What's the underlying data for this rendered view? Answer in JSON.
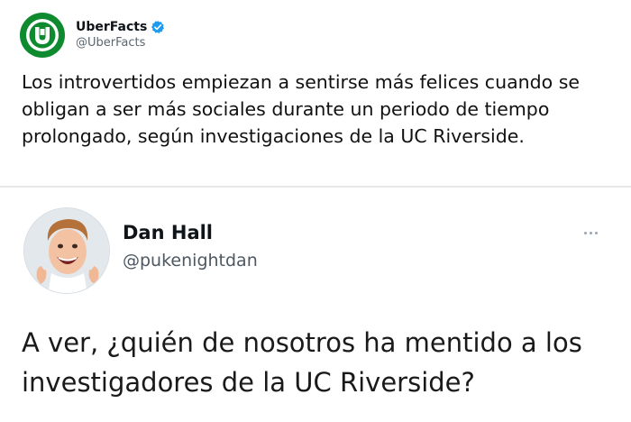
{
  "quoted_tweet": {
    "avatar_icon": "uberfacts-logo-icon",
    "brand_color": "#0f8a2f",
    "author_name": "UberFacts",
    "verified_icon": "verified-badge-icon",
    "verified_color": "#1d9bf0",
    "handle": "@UberFacts",
    "text": "Los introvertidos empiezan a sentirse más felices cuando se obligan a ser más sociales durante un periodo de tiempo prolongado, según investigaciones de la UC Riverside."
  },
  "reply_tweet": {
    "avatar_icon": "profile-photo",
    "author_name": "Dan Hall",
    "handle": "@pukenightdan",
    "more_icon": "more-options-icon",
    "text": "A ver, ¿quién de nosotros ha mentido a los investigadores de la UC Riverside?"
  }
}
